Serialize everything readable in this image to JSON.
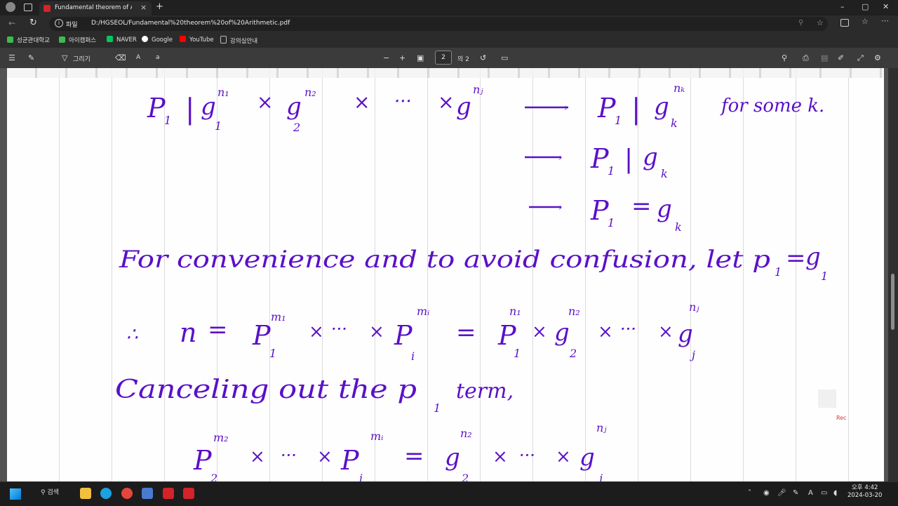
{
  "browser": {
    "tab_title": "Fundamental theorem of Arithm",
    "tab_close": "×",
    "new_tab": "+",
    "back": "←",
    "reload": "↻",
    "address_label": "파일",
    "url": "D:/HGSEOL/Fundamental%20theorem%20of%20Arithmetic.pdf",
    "window": {
      "minimize": "–",
      "maximize": "▢",
      "close": "✕"
    }
  },
  "bookmarks": [
    {
      "label": "성균관대학교",
      "icon_color": "#3fb950"
    },
    {
      "label": "아이캠퍼스",
      "icon_color": "#3fb950"
    },
    {
      "label": "NAVER",
      "icon_color": "#03c75a"
    },
    {
      "label": "Google",
      "icon_color": "#ffffff"
    },
    {
      "label": "YouTube",
      "icon_color": "#ff0000"
    },
    {
      "label": "강의실안내",
      "icon_color": "#bbbbbb"
    }
  ],
  "pdf_toolbar": {
    "draw_label": "그리기",
    "read_aloud": "A",
    "translate": "a",
    "zoom_out": "−",
    "zoom_in": "+",
    "page_current": "2",
    "page_total": "의 2"
  },
  "notes": {
    "ink_color": "#5a10c8",
    "line1": "for some k.",
    "line4": "For convenience and to avoid confusion, let p",
    "line6": "Canceling out the p",
    "line6_end": "term,"
  },
  "rec_label": "Rec",
  "taskbar": {
    "search_label": "검색",
    "time": "오후 4:42",
    "date": "2024-03-20"
  }
}
